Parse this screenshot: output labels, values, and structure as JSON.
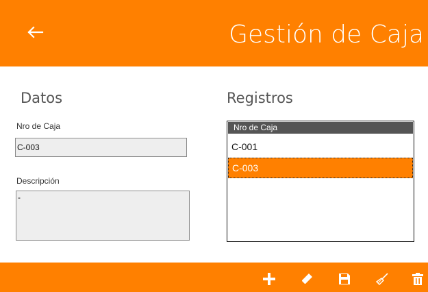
{
  "header": {
    "title": "Gestión de Caja",
    "back_icon": "arrow-left-icon"
  },
  "datos": {
    "section_title": "Datos",
    "nro_label": "Nro de Caja",
    "nro_value": "C-003",
    "desc_label": "Descripción",
    "desc_value": "-"
  },
  "registros": {
    "section_title": "Registros",
    "column_header": "Nro de Caja",
    "rows": [
      {
        "nro": "C-001",
        "selected": false
      },
      {
        "nro": "C-003",
        "selected": true
      }
    ]
  },
  "toolbar": {
    "icons": [
      "plus-icon",
      "pencil-icon",
      "save-icon",
      "broom-icon",
      "trash-icon"
    ]
  },
  "colors": {
    "accent": "#ff8000",
    "grid_header": "#555555",
    "field_bg": "#eeeeee"
  }
}
